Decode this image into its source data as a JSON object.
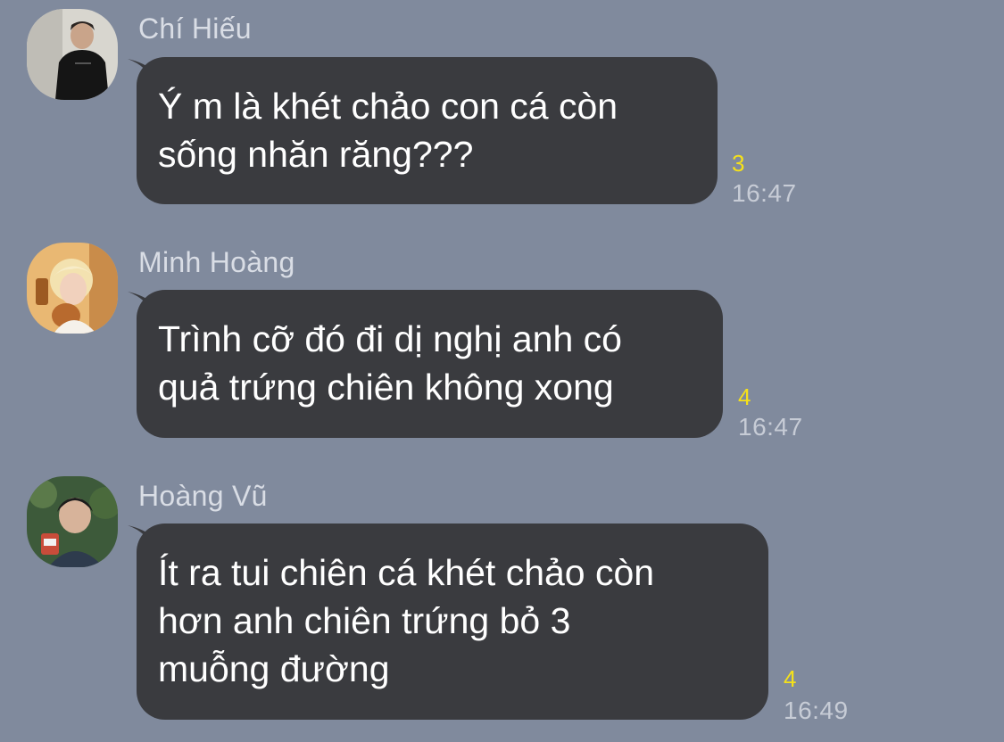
{
  "messages": [
    {
      "sender": "Chí Hiếu",
      "avatar": "avatar-chi-hieu",
      "lines": [
        "Ý m là khét chảo con cá còn",
        "sống nhăn răng???"
      ],
      "read_count": "3",
      "time": "16:47"
    },
    {
      "sender": "Minh Hoàng",
      "avatar": "avatar-minh-hoang",
      "lines": [
        "Trình cỡ đó đi dị nghị anh có",
        "quả trứng chiên không xong"
      ],
      "read_count": "4",
      "time": "16:47"
    },
    {
      "sender": "Hoàng Vũ",
      "avatar": "avatar-hoang-vu",
      "lines": [
        "Ít ra tui chiên cá khét chảo còn",
        "hơn anh chiên trứng bỏ 3",
        "muỗng đường"
      ],
      "read_count": "4",
      "time": "16:49"
    }
  ],
  "colors": {
    "background": "#808a9d",
    "bubble": "#3a3b3f",
    "read_count": "#f5e11a",
    "timestamp": "#c7ccd6",
    "sender": "#d9dde5"
  }
}
